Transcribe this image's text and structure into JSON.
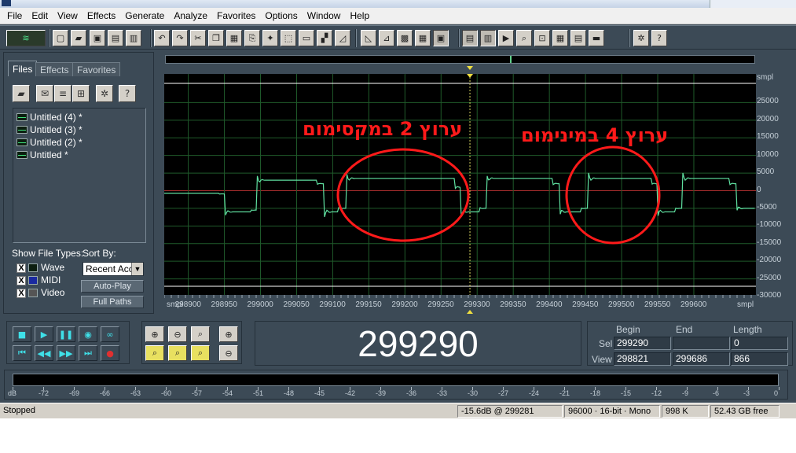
{
  "menu": [
    "File",
    "Edit",
    "View",
    "Effects",
    "Generate",
    "Analyze",
    "Favorites",
    "Options",
    "Window",
    "Help"
  ],
  "toolbar_icons": [
    "wave-logo-icon",
    "new-file-icon",
    "open-file-icon",
    "save-icon",
    "save-all-icon",
    "close-file-icon",
    "undo-icon",
    "redo-icon",
    "cut-icon",
    "copy-icon",
    "paste-icon",
    "mix-paste-icon",
    "trim-icon",
    "crop-icon",
    "mute-icon",
    "envelope-icon",
    "fade-in-icon",
    "fade-out-icon",
    "effect-1-icon",
    "effect-2-icon",
    "effect-3-icon",
    "view-1-icon",
    "view-2-icon",
    "view-3-icon",
    "play-icon",
    "zoom-icon",
    "range-icon",
    "spectrum-icon",
    "color-icon",
    "marker-icon",
    "settings-icon",
    "help-icon"
  ],
  "left_panel": {
    "tabs": [
      "Files",
      "Effects",
      "Favorites"
    ],
    "files": [
      "Untitled (4) *",
      "Untitled (3) *",
      "Untitled (2) *",
      "Untitled *"
    ],
    "show_types_label": "Show File Types:",
    "sort_by_label": "Sort By:",
    "types": [
      {
        "label": "Wave",
        "checked": "X"
      },
      {
        "label": "MIDI",
        "checked": "X"
      },
      {
        "label": "Video",
        "checked": "X"
      }
    ],
    "sort_value": "Recent Acc",
    "auto_play": "Auto-Play",
    "full_paths": "Full Paths"
  },
  "waveform": {
    "unit_top": "smpl",
    "y_labels": [
      "25000",
      "20000",
      "15000",
      "10000",
      "5000",
      "0",
      "-5000",
      "-10000",
      "-15000",
      "-20000",
      "-25000",
      "-30000"
    ],
    "x_unit": "smpl",
    "x_labels": [
      "298900",
      "298950",
      "299000",
      "299050",
      "299100",
      "299150",
      "299200",
      "299250",
      "299300",
      "299350",
      "299400",
      "299450",
      "299500",
      "299550",
      "299600"
    ],
    "x_unit_end": "smpl",
    "annotation_left": "ערוץ 2 במקסימום",
    "annotation_right": "ערוץ 4 במינימום",
    "annotation_color": "#ff1a1a",
    "wave_color": "#5fe0a0",
    "grid_color": "#1f5a2a",
    "zero_line_color": "#b03030"
  },
  "time_display": "299290",
  "selection": {
    "headers": {
      "begin": "Begin",
      "end": "End",
      "length": "Length"
    },
    "sel_label": "Sel",
    "view_label": "View",
    "sel": {
      "begin": "299290",
      "end": "",
      "length": "0"
    },
    "view": {
      "begin": "298821",
      "end": "299686",
      "length": "866"
    }
  },
  "meter_labels": [
    "dB",
    "-72",
    "-69",
    "-66",
    "-63",
    "-60",
    "-57",
    "-54",
    "-51",
    "-48",
    "-45",
    "-42",
    "-39",
    "-36",
    "-33",
    "-30",
    "-27",
    "-24",
    "-21",
    "-18",
    "-15",
    "-12",
    "-9",
    "-6",
    "-3",
    "0"
  ],
  "status": {
    "state": "Stopped",
    "peak": "-15.6dB @ 299281",
    "format": "96000 · 16-bit · Mono",
    "size": "998 K",
    "free": "52.43 GB free"
  }
}
